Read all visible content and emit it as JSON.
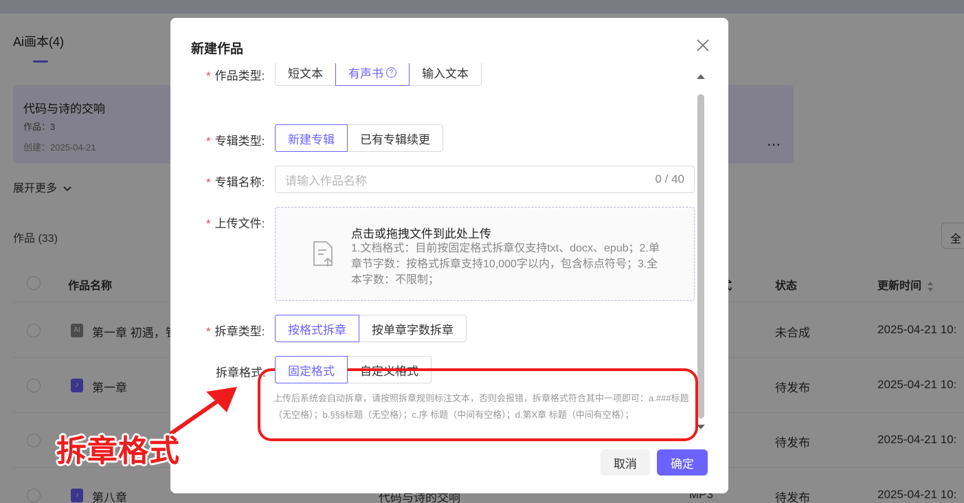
{
  "background": {
    "page_title": "Ai画本(4)",
    "album": {
      "name": "代码与诗的交响",
      "works": "作品：3",
      "created": "创建：2025-04-21",
      "more": "⋯"
    },
    "expand_more": "展开更多",
    "works_title": "作品 (33)",
    "filter_label": "全",
    "columns": {
      "name": "作品名称",
      "format": "式",
      "status": "状态",
      "updated": "更新时间"
    },
    "rows": [
      {
        "name": "第一章 初遇，钅",
        "album": "",
        "format": "",
        "status": "未合成",
        "updated": "2025-04-21 10:",
        "icon": "ai-icon"
      },
      {
        "name": "第一章",
        "album": "",
        "format": "",
        "status": "待发布",
        "updated": "2025-04-21 10:",
        "icon": "audio-icon"
      },
      {
        "name": "",
        "album": "",
        "format": "",
        "status": "待发布",
        "updated": "2025-04-21 10:",
        "icon": ""
      },
      {
        "name": "第八章",
        "album": "代码与诗的交响",
        "format": "MP3",
        "status": "待发布",
        "updated": "2025-04-21 10:",
        "icon": "audio-icon"
      }
    ]
  },
  "modal": {
    "title": "新建作品",
    "fields": {
      "work_type": {
        "label": "作品类型:",
        "options": [
          "短文本",
          "有声书",
          "输入文本"
        ],
        "selected": "有声书"
      },
      "album_type": {
        "label": "专辑类型:",
        "options": [
          "新建专辑",
          "已有专辑续更"
        ],
        "selected": "新建专辑"
      },
      "album_name": {
        "label": "专辑名称:",
        "placeholder": "请输入作品名称",
        "counter": "0 / 40"
      },
      "upload": {
        "label": "上传文件:",
        "title": "点击或拖拽文件到此处上传",
        "description": "1.文档格式：目前按固定格式拆章仅支持txt、docx、epub；2.单章节字数：按格式拆章支持10,000字以内，包含标点符号；3.全本字数：不限制；"
      },
      "split_type": {
        "label": "拆章类型:",
        "options": [
          "按格式拆章",
          "按单章字数拆章"
        ],
        "selected": "按格式拆章"
      },
      "split_format": {
        "label": "拆章格式:",
        "options": [
          "固定格式",
          "自定义格式"
        ],
        "selected": "固定格式"
      }
    },
    "hint": "上传后系统会自动拆章，请按照拆章规则标注文本，否则会报错，拆章格式符合其中一项即可：a.###标题（无空格）；b.§§§标题（无空格）；c.序 标题（中间有空格）；d.第X章 标题（中间有空格）；",
    "buttons": {
      "cancel": "取消",
      "confirm": "确定"
    }
  },
  "annotation": {
    "label": "拆章格式",
    "color": "#ee1c1c"
  },
  "colors": {
    "accent": "#6c63ff",
    "required": "#e5484d"
  }
}
